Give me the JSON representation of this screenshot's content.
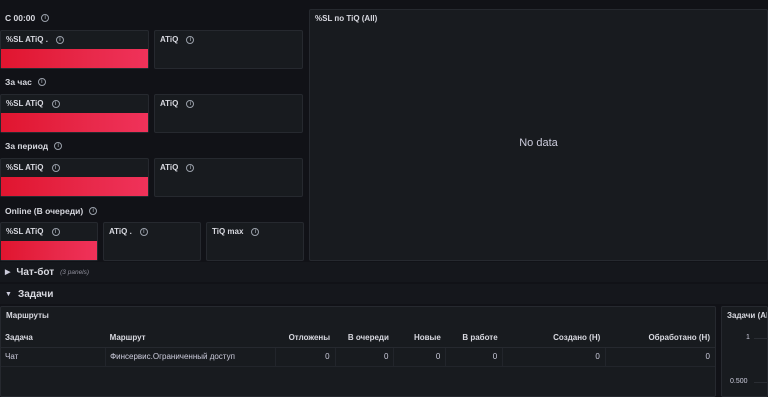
{
  "groups": {
    "since_midnight": "С 00:00",
    "per_hour": "За час",
    "per_period": "За период",
    "online": "Online (В очереди)"
  },
  "panels": {
    "sl_atiq_dot": "%SL ATiQ .",
    "sl_atiq": "%SL ATiQ",
    "atiq": "ATiQ",
    "atiq_dot": "ATiQ .",
    "tiq_max": "TiQ max",
    "sl_by_tiq": "%SL по TiQ (All)",
    "no_data": "No data"
  },
  "rows": {
    "chatbot": "Чат-бот",
    "chatbot_sub": "(3 panels)",
    "tasks": "Задачи"
  },
  "routes_table": {
    "title": "Маршруты",
    "columns": [
      "Задача",
      "Маршрут",
      "Отложены",
      "В очереди",
      "Новые",
      "В работе",
      "Создано (Н)",
      "Обработано (Н)"
    ],
    "rows": [
      [
        "Чат",
        "Финсервис.Ограниченный доступ",
        "0",
        "0",
        "0",
        "0",
        "0",
        "0"
      ]
    ]
  },
  "tasks_chart": {
    "title": "Задачи (All",
    "y_ticks": [
      "1",
      "0.500"
    ]
  },
  "icons": {
    "info": "info-icon",
    "chevron_right": "chevron-right-icon",
    "chevron_down": "chevron-down-icon"
  },
  "colors": {
    "bar_red": "#e0152f",
    "panel_bg": "#181b1f",
    "page_bg": "#111217"
  }
}
